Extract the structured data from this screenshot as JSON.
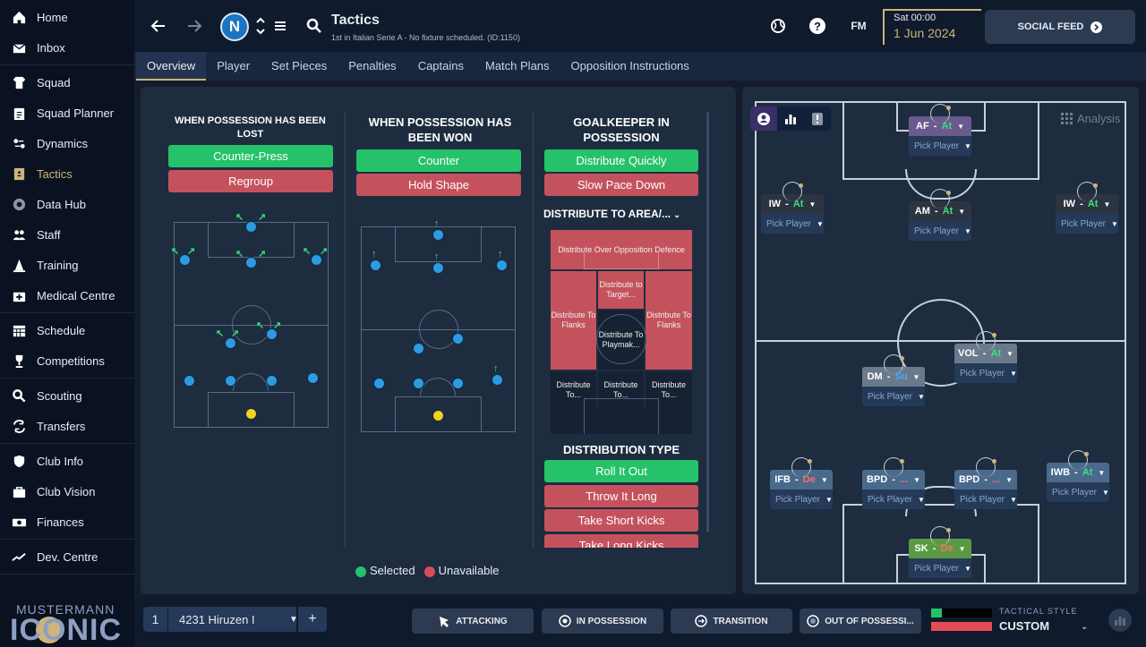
{
  "sidebar": {
    "groups": [
      [
        {
          "label": "Home",
          "icon": "home-icon"
        },
        {
          "label": "Inbox",
          "icon": "inbox-icon"
        }
      ],
      [
        {
          "label": "Squad",
          "icon": "shirt-icon"
        },
        {
          "label": "Squad Planner",
          "icon": "clipboard-icon"
        },
        {
          "label": "Dynamics",
          "icon": "dynamics-icon"
        },
        {
          "label": "Tactics",
          "icon": "tactics-board-icon",
          "active": true
        },
        {
          "label": "Data Hub",
          "icon": "data-hub-icon"
        },
        {
          "label": "Staff",
          "icon": "staff-icon"
        },
        {
          "label": "Training",
          "icon": "training-cone-icon"
        },
        {
          "label": "Medical Centre",
          "icon": "medical-icon"
        }
      ],
      [
        {
          "label": "Schedule",
          "icon": "calendar-icon"
        },
        {
          "label": "Competitions",
          "icon": "trophy-icon"
        }
      ],
      [
        {
          "label": "Scouting",
          "icon": "magnifier-icon"
        },
        {
          "label": "Transfers",
          "icon": "transfer-icon"
        }
      ],
      [
        {
          "label": "Club Info",
          "icon": "shield-icon"
        },
        {
          "label": "Club Vision",
          "icon": "briefcase-icon"
        },
        {
          "label": "Finances",
          "icon": "money-icon"
        }
      ],
      [
        {
          "label": "Dev. Centre",
          "icon": "dev-centre-icon"
        }
      ]
    ],
    "brand_top": "MUSTERMANN",
    "brand_bottom": "ICONIC"
  },
  "header": {
    "title": "Tactics",
    "subtitle": "1st in Italian Serie A - No fixture scheduled. (ID:1150)",
    "crest_letter": "N",
    "date_day": "Sat 00:00",
    "date_date": "1 Jun 2024",
    "fm_label": "FM",
    "social_feed": "SOCIAL FEED"
  },
  "tabs": [
    "Overview",
    "Player",
    "Set Pieces",
    "Penalties",
    "Captains",
    "Match Plans",
    "Opposition Instructions"
  ],
  "overview": {
    "lost": {
      "title": "WHEN POSSESSION HAS BEEN LOST",
      "options": [
        {
          "label": "Counter-Press",
          "state": "selected"
        },
        {
          "label": "Regroup",
          "state": "unavailable"
        }
      ]
    },
    "won": {
      "title": "WHEN POSSESSION HAS BEEN WON",
      "options": [
        {
          "label": "Counter",
          "state": "selected"
        },
        {
          "label": "Hold Shape",
          "state": "unavailable"
        }
      ]
    },
    "gk": {
      "title": "GOALKEEPER IN POSSESSION",
      "options": [
        {
          "label": "Distribute Quickly",
          "state": "selected"
        },
        {
          "label": "Slow Pace Down",
          "state": "unavailable"
        }
      ]
    },
    "distribute_area_title": "DISTRIBUTE TO AREA/...",
    "zones": {
      "over": "Distribute Over Opposition Defence",
      "target": "Distribute to Target...",
      "flanks_l": "Distribute To Flanks",
      "flanks_r": "Distribute To Flanks",
      "playmaker": "Distribute To Playmak...",
      "bl": "Distribute To...",
      "bm": "Distribute To...",
      "br": "Distribute To..."
    },
    "dist_type_title": "DISTRIBUTION TYPE",
    "dist_types": [
      {
        "label": "Roll It Out",
        "state": "selected"
      },
      {
        "label": "Throw It Long",
        "state": "unavailable"
      },
      {
        "label": "Take Short Kicks",
        "state": "unavailable"
      },
      {
        "label": "Take Long Kicks",
        "state": "unavailable"
      }
    ],
    "legend": {
      "selected": "Selected",
      "unavailable": "Unavailable"
    }
  },
  "pitch": {
    "analysis": "Analysis",
    "players": [
      {
        "id": "af",
        "role": "AF",
        "duty": "At",
        "duty_class": "d-at",
        "color": "r-purple",
        "pick": "Pick Player"
      },
      {
        "id": "iwl",
        "role": "IW",
        "duty": "At",
        "duty_class": "d-at",
        "color": "r-dark",
        "pick": "Pick Player"
      },
      {
        "id": "am",
        "role": "AM",
        "duty": "At",
        "duty_class": "d-at",
        "color": "r-dark",
        "pick": "Pick Player"
      },
      {
        "id": "iwr",
        "role": "IW",
        "duty": "At",
        "duty_class": "d-at",
        "color": "r-dark",
        "pick": "Pick Player"
      },
      {
        "id": "vol",
        "role": "VOL",
        "duty": "At",
        "duty_class": "d-at",
        "color": "r-grey",
        "pick": "Pick Player"
      },
      {
        "id": "dm",
        "role": "DM",
        "duty": "Su",
        "duty_class": "d-su",
        "color": "r-grey",
        "pick": "Pick Player"
      },
      {
        "id": "ifb",
        "role": "IFB",
        "duty": "De",
        "duty_class": "d-de",
        "color": "r-mid",
        "pick": "Pick Player"
      },
      {
        "id": "bpd1",
        "role": "BPD",
        "duty": "...",
        "duty_class": "d-de",
        "color": "r-mid",
        "pick": "Pick Player"
      },
      {
        "id": "bpd2",
        "role": "BPD",
        "duty": "...",
        "duty_class": "d-de",
        "color": "r-mid",
        "pick": "Pick Player"
      },
      {
        "id": "iwb",
        "role": "IWB",
        "duty": "At",
        "duty_class": "d-at",
        "color": "r-mid",
        "pick": "Pick Player"
      },
      {
        "id": "sk",
        "role": "SK",
        "duty": "De",
        "duty_class": "d-de",
        "color": "r-green",
        "pick": "Pick Player"
      }
    ]
  },
  "bottom": {
    "tactic_num": "1",
    "tactic_name": "4231 Hiruzen I",
    "add": "+",
    "phases": [
      "ATTACKING",
      "IN POSSESSION",
      "TRANSITION",
      "OUT OF POSSESSI..."
    ],
    "style_label": "TACTICAL STYLE",
    "style_value": "CUSTOM"
  }
}
